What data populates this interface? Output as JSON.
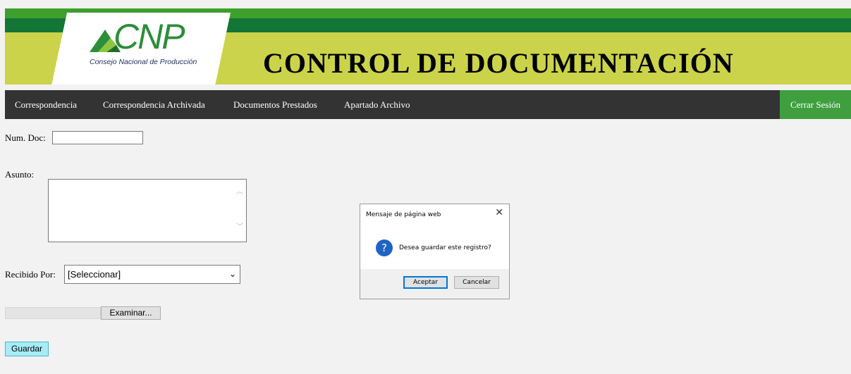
{
  "header": {
    "logo_text": "CNP",
    "logo_subtitle": "Consejo Nacional de Producción",
    "title": "CONTROL DE DOCUMENTACIÓN"
  },
  "nav": {
    "items": [
      {
        "label": "Correspondencia"
      },
      {
        "label": "Correspondencia Archivada"
      },
      {
        "label": "Documentos Prestados"
      },
      {
        "label": "Apartado Archivo"
      }
    ],
    "logout_label": "Cerrar Sesión"
  },
  "form": {
    "num_doc_label": "Num. Doc:",
    "num_doc_value": "",
    "asunto_label": "Asunto:",
    "asunto_value": "",
    "recibido_label": "Recibido Por:",
    "recibido_selected": "[Seleccionar]",
    "file_button_label": "Examinar...",
    "save_label": "Guardar"
  },
  "dialog": {
    "title": "Mensaje de página web",
    "close_glyph": "✕",
    "message": "Desea guardar este registro?",
    "ok_label": "Aceptar",
    "cancel_label": "Cancelar"
  },
  "colors": {
    "banner": "#cbd34a",
    "stripe_light": "#3ea02c",
    "stripe_dark": "#137536",
    "nav_bg": "#333333",
    "logout_bg": "#3f9f3f",
    "save_bg": "#a6ecf7",
    "question_icon": "#1f64c4"
  },
  "icons": {
    "logo_mark": "cnp-leaf-logo-icon",
    "question": "question-icon",
    "close": "close-icon",
    "chevron": "chevron-down-icon"
  }
}
